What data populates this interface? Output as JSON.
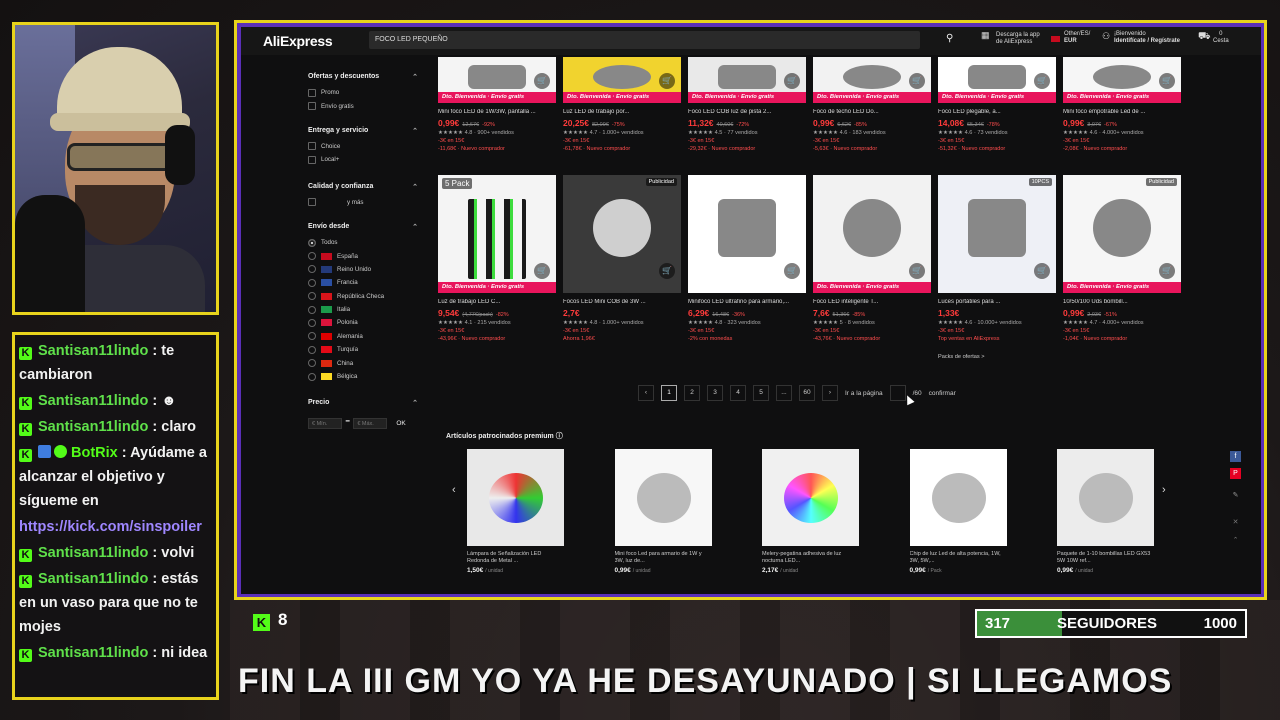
{
  "chat": {
    "messages": [
      {
        "user": "Santisan11lindo",
        "text": "te cambiaron"
      },
      {
        "user": "Santisan11lindo",
        "text": "☻"
      },
      {
        "user": "Santisan11lindo",
        "text": "claro"
      },
      {
        "user": "BotRix",
        "text": "Ayúdame a alcanzar el objetivo y sígueme en"
      },
      {
        "link": "https://kick.com/sinspoiler"
      },
      {
        "user": "Santisan11lindo",
        "text": "volvi"
      },
      {
        "user": "Santisan11lindo",
        "text": "estás en un vaso para que no te mojes"
      },
      {
        "user": "Santisan11lindo",
        "text": "ni idea"
      }
    ]
  },
  "stream": {
    "viewer_count": "8",
    "followers_current": "317",
    "followers_label": "SEGUIDORES",
    "followers_goal": "1000",
    "followers_progress_fraction": 0.317,
    "ticker": "FIN LA III GM YO YA HE DESAYUNADO | SI LLEGAMOS"
  },
  "header": {
    "logo": "AliExpress",
    "search_value": "FOCO LED PEQUEÑO",
    "app_download": "Descarga la app de AliExpress",
    "region_line1": "Other/ES/",
    "region_line2": "EUR",
    "account_line1": "¡Bienvenido",
    "account_line2": "Identifícate / Regístrate",
    "cart_count": "0",
    "cart_label": "Cesta"
  },
  "sidebar": {
    "offers_title": "Ofertas y descuentos",
    "offers": [
      "Promo",
      "Envío gratis"
    ],
    "delivery_title": "Entrega y servicio",
    "delivery": [
      "Choice",
      "Local+"
    ],
    "quality_title": "Calidad y confianza",
    "quality_option": "y más",
    "shipfrom_title": "Envío desde",
    "countries": [
      {
        "name": "Todos",
        "color": ""
      },
      {
        "name": "España",
        "color": "#c60b1e"
      },
      {
        "name": "Reino Unido",
        "color": "#243a7a"
      },
      {
        "name": "Francia",
        "color": "#2a4fa3"
      },
      {
        "name": "República Checa",
        "color": "#d7141a"
      },
      {
        "name": "Italia",
        "color": "#1b9a4b"
      },
      {
        "name": "Polonia",
        "color": "#dc143c"
      },
      {
        "name": "Alemania",
        "color": "#dd0000"
      },
      {
        "name": "Turquía",
        "color": "#e30a17"
      },
      {
        "name": "China",
        "color": "#de2910"
      },
      {
        "name": "Bélgica",
        "color": "#fdda24"
      }
    ],
    "price_title": "Precio",
    "price_min": "€ Mín.",
    "price_max": "€ Máx.",
    "ok": "OK"
  },
  "products_row1": [
    {
      "title": "Mini foco LED de 1W/3W, pantalla ...",
      "price": "0,99€",
      "old": "12,67€",
      "off": "-92%",
      "sold": "4.8 · 900+ vendidos",
      "coupon": "-3€ en 15€",
      "extra": "-11,68€ · Nuevo comprador",
      "badge": "Dto. Bienvenida · Envío gratis",
      "bg": "#f4f4f4"
    },
    {
      "title": "Luz LED de trabajo por...",
      "price": "20,25€",
      "old": "82,09€",
      "off": "-75%",
      "sold": "4.7 · 1.000+ vendidos",
      "coupon": "-3€ en 15€",
      "extra": "-61,78€ · Nuevo comprador",
      "badge": "Dto. Bienvenida · Envío gratis",
      "bg": "#f1d32e"
    },
    {
      "title": "Foco LED COB luz de pista 2...",
      "price": "11,32€",
      "old": "40,60€",
      "off": "-72%",
      "sold": "4.5 · 77 vendidos",
      "coupon": "-3€ en 15€",
      "extra": "-29,32€ · Nuevo comprador",
      "badge": "Dto. Bienvenida · Envío gratis",
      "bg": "#e9e9e9"
    },
    {
      "title": "Foco de techo LED Do...",
      "price": "0,99€",
      "old": "6,62€",
      "off": "-85%",
      "sold": "4.6 · 183 vendidos",
      "coupon": "-3€ en 15€",
      "extra": "-5,63€ · Nuevo comprador",
      "badge": "Dto. Bienvenida · Envío gratis",
      "bg": "#f2f2f2"
    },
    {
      "title": "Foco LED plegable, a...",
      "price": "14,08€",
      "old": "65,34€",
      "off": "-78%",
      "sold": "4.6 · 73 vendidos",
      "coupon": "-3€ en 15€",
      "extra": "-51,32€ · Nuevo comprador",
      "badge": "Dto. Bienvenida · Envío gratis",
      "bg": "#ffffff"
    },
    {
      "title": "Mini foco empotrable Led de ...",
      "price": "0,99€",
      "old": "3,07€",
      "off": "-67%",
      "sold": "4.6 · 4.000+ vendidos",
      "coupon": "-3€ en 15€",
      "extra": "-2,08€ · Nuevo comprador",
      "badge": "Dto. Bienvenida · Envío gratis",
      "bg": "#f6f6f6"
    }
  ],
  "products_row2": [
    {
      "title": "Luz de trabajo LED C...",
      "price": "9,54€",
      "old": "(4,77€/pack)",
      "off": "-82%",
      "sold": "4.1 · 215 vendidos",
      "coupon": "-3€ en 15€",
      "extra": "-43,96€ · Nuevo comprador",
      "badge": "Dto. Bienvenida · Envío gratis",
      "bg": "#f4f4f4",
      "corner": "5 Pack"
    },
    {
      "title": "Focos LED Mini COB de 3W ...",
      "price": "2,7€",
      "old": "",
      "off": "",
      "sold": "4.8 · 1.000+ vendidos",
      "coupon": "-3€ en 15€",
      "extra": "Ahorra 1,96€",
      "badge": "",
      "bg": "#3a3a3a",
      "corner": "Publicidad"
    },
    {
      "title": "Minifoco LED ultrafino para armario,...",
      "price": "6,29€",
      "old": "16,48€",
      "off": "-36%",
      "sold": "4.8 · 323 vendidos",
      "coupon": "-3€ en 15€",
      "extra": "-2% con monedas",
      "badge": "",
      "bg": "#ffffff",
      "corner": ""
    },
    {
      "title": "Foco LED inteligente T...",
      "price": "7,6€",
      "old": "51,36€",
      "off": "-85%",
      "sold": "5 · 8 vendidos",
      "coupon": "-3€ en 15€",
      "extra": "-43,76€ · Nuevo comprador",
      "badge": "Dto. Bienvenida · Envío gratis",
      "bg": "#f2f2f2",
      "corner": ""
    },
    {
      "title": "Luces portátiles para ...",
      "price": "1,33€",
      "old": "",
      "off": "",
      "sold": "4.6 · 10.000+ vendidos",
      "coupon": "-3€ en 15€",
      "extra": "Top ventas en AliExpress",
      "badge": "",
      "bg": "#eef0f6",
      "corner": "10PCS"
    },
    {
      "title": "10/50/100 Uds bombill...",
      "price": "0,99€",
      "old": "2,03€",
      "off": "-51%",
      "sold": "4.7 · 4.000+ vendidos",
      "coupon": "-3€ en 15€",
      "extra": "-1,04€ · Nuevo comprador",
      "badge": "Dto. Bienvenida · Envío gratis",
      "bg": "#f6f6f6",
      "corner": "Publicidad"
    }
  ],
  "extra_link": "Packs de ofertas >",
  "pagination": {
    "pages": [
      "1",
      "2",
      "3",
      "4",
      "5",
      "...",
      "60"
    ],
    "goto_label": "Ir a la página",
    "total": "/60",
    "confirm": "confirmar"
  },
  "sponsored": {
    "title": "Artículos patrocinados premium",
    "items": [
      {
        "title": "Lámpara de Señalización LED Redonda de Metal ...",
        "price": "1,50€",
        "unit": "/ unidad",
        "bg": "#e8e8e8"
      },
      {
        "title": "Mini foco Led para armario de 1W y 3W, luz de...",
        "price": "0,99€",
        "unit": "/ unidad",
        "bg": "#f7f7f7"
      },
      {
        "title": "Melery-pegatina adhesiva de luz nocturna LED...",
        "price": "2,17€",
        "unit": "/ unidad",
        "bg": "#f0f0f0"
      },
      {
        "title": "Chip de luz Led de alta potencia, 1W, 3W, 5W,...",
        "price": "0,99€",
        "unit": "/ Pack",
        "bg": "#ffffff"
      },
      {
        "title": "Paquete de 1-10 bombillas LED GX53 5W 10W ref...",
        "price": "0,99€",
        "unit": "/ unidad",
        "bg": "#ececec"
      }
    ]
  }
}
